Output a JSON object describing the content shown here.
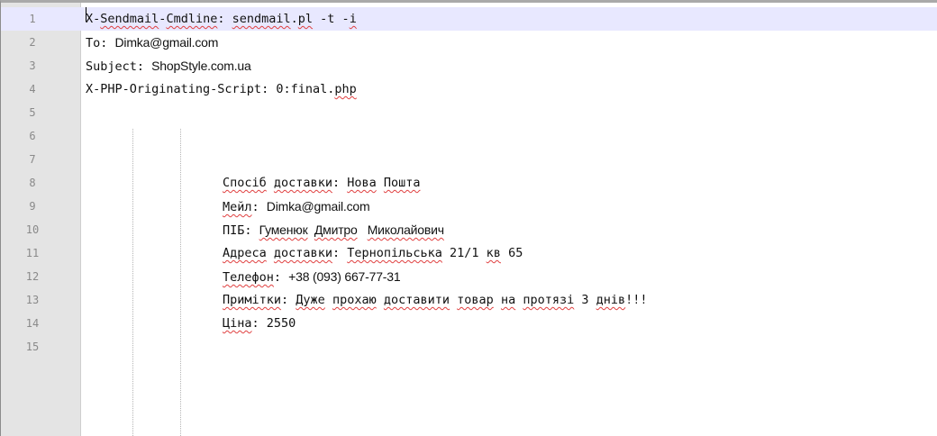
{
  "editor": {
    "lines": [
      {
        "num": "1",
        "indent": "",
        "segments": [
          {
            "text": "X-",
            "style": "plain"
          },
          {
            "text": "Sendmail",
            "style": "spell"
          },
          {
            "text": "-",
            "style": "plain"
          },
          {
            "text": "Cmdline",
            "style": "spell"
          },
          {
            "text": ": ",
            "style": "plain"
          },
          {
            "text": "sendmail",
            "style": "spell"
          },
          {
            "text": ".",
            "style": "plain"
          },
          {
            "text": "pl",
            "style": "spell"
          },
          {
            "text": " -t -",
            "style": "plain"
          },
          {
            "text": "i",
            "style": "spell"
          }
        ]
      },
      {
        "num": "2",
        "indent": "",
        "segments": [
          {
            "text": "To: ",
            "style": "plain"
          },
          {
            "text": "Dimka@gmail.com",
            "style": "prop"
          }
        ]
      },
      {
        "num": "3",
        "indent": "",
        "segments": [
          {
            "text": "Subject: ",
            "style": "plain"
          },
          {
            "text": "ShopStyle.com.ua",
            "style": "prop"
          }
        ]
      },
      {
        "num": "4",
        "indent": "",
        "segments": [
          {
            "text": "X-PHP-Originating-Script: 0:final.",
            "style": "plain"
          },
          {
            "text": "php",
            "style": "spell"
          }
        ]
      },
      {
        "num": "5",
        "indent": "",
        "segments": []
      },
      {
        "num": "6",
        "indent": "",
        "segments": []
      },
      {
        "num": "7",
        "indent": "",
        "segments": []
      },
      {
        "num": "8",
        "indent": "2",
        "segments": [
          {
            "text": "Спосіб",
            "style": "spell"
          },
          {
            "text": " ",
            "style": "plain"
          },
          {
            "text": "доставки",
            "style": "spell"
          },
          {
            "text": ": ",
            "style": "plain"
          },
          {
            "text": "Нова",
            "style": "spell"
          },
          {
            "text": " ",
            "style": "plain"
          },
          {
            "text": "Пошта",
            "style": "spell"
          }
        ]
      },
      {
        "num": "9",
        "indent": "2",
        "segments": [
          {
            "text": "Мейл",
            "style": "spell"
          },
          {
            "text": ": ",
            "style": "plain"
          },
          {
            "text": "Dimka@gmail.com",
            "style": "prop"
          }
        ]
      },
      {
        "num": "10",
        "indent": "2",
        "segments": [
          {
            "text": "ПІБ: ",
            "style": "plain"
          },
          {
            "text": "Гуменюк",
            "style": "prop-spell"
          },
          {
            "text": "  ",
            "style": "prop"
          },
          {
            "text": "Дмитро",
            "style": "prop-spell"
          },
          {
            "text": "   ",
            "style": "prop"
          },
          {
            "text": "Миколайович",
            "style": "prop-spell"
          }
        ]
      },
      {
        "num": "11",
        "indent": "2",
        "segments": [
          {
            "text": "Адреса",
            "style": "spell"
          },
          {
            "text": " ",
            "style": "plain"
          },
          {
            "text": "доставки",
            "style": "spell"
          },
          {
            "text": ": ",
            "style": "plain"
          },
          {
            "text": "Тернопільська",
            "style": "spell"
          },
          {
            "text": " 21/1 ",
            "style": "plain"
          },
          {
            "text": "кв",
            "style": "spell"
          },
          {
            "text": " 65",
            "style": "plain"
          }
        ]
      },
      {
        "num": "12",
        "indent": "2",
        "segments": [
          {
            "text": "Телефон",
            "style": "spell"
          },
          {
            "text": ": ",
            "style": "plain"
          },
          {
            "text": "+38 (093) 667-77-31",
            "style": "prop"
          }
        ]
      },
      {
        "num": "13",
        "indent": "2",
        "segments": [
          {
            "text": "Примітки",
            "style": "spell"
          },
          {
            "text": ": ",
            "style": "plain"
          },
          {
            "text": "Дуже",
            "style": "spell"
          },
          {
            "text": " ",
            "style": "plain"
          },
          {
            "text": "прохаю",
            "style": "spell"
          },
          {
            "text": " ",
            "style": "plain"
          },
          {
            "text": "доставити",
            "style": "spell"
          },
          {
            "text": " ",
            "style": "plain"
          },
          {
            "text": "товар",
            "style": "spell"
          },
          {
            "text": " ",
            "style": "plain"
          },
          {
            "text": "на",
            "style": "spell"
          },
          {
            "text": " ",
            "style": "plain"
          },
          {
            "text": "протязі",
            "style": "spell"
          },
          {
            "text": " 3 ",
            "style": "plain"
          },
          {
            "text": "днів",
            "style": "spell"
          },
          {
            "text": "!!!",
            "style": "plain"
          }
        ]
      },
      {
        "num": "14",
        "indent": "2",
        "segments": [
          {
            "text": "Ціна",
            "style": "spell"
          },
          {
            "text": ": 2550",
            "style": "plain"
          }
        ]
      },
      {
        "num": "15",
        "indent": "",
        "segments": []
      }
    ]
  },
  "colors": {
    "gutter_bg": "#e4e4e4",
    "line_number": "#8a8a8a",
    "current_line_bg": "#e8e8ff",
    "spellcheck_underline": "#e04040",
    "text": "#111111"
  }
}
